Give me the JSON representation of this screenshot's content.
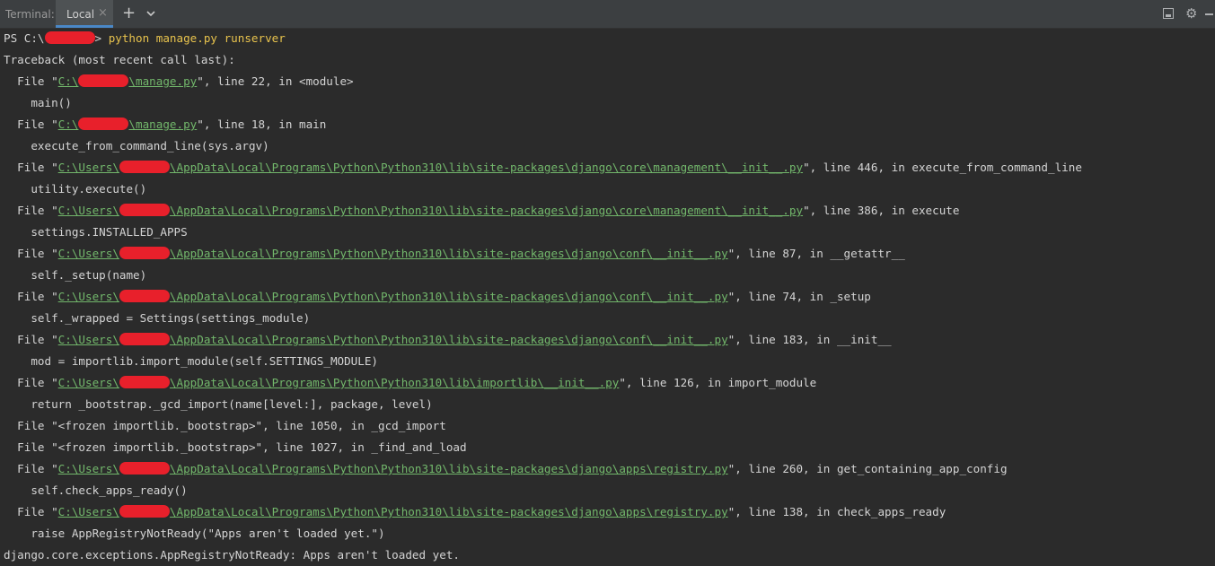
{
  "tabbar": {
    "title": "Terminal:",
    "tab_label": "Local",
    "close_glyph": "×",
    "add_glyph": "+",
    "icons": [
      "new-tab-icon",
      "tab-list-chevron-icon",
      "hide-panel-icon",
      "gear-icon",
      "minimize-icon"
    ]
  },
  "prompt": {
    "prefix": "PS C:\\",
    "suffix": ">",
    "command": "python manage.py runserver"
  },
  "trace": {
    "header": "Traceback (most recent call last):",
    "frames": [
      {
        "file_open": "  File \"",
        "path_a": "C:\\",
        "path_b": "\\manage.py",
        "rest": "\", line 22, in <module>",
        "code": "    main()"
      },
      {
        "file_open": "  File \"",
        "path_a": "C:\\",
        "path_b": "\\manage.py",
        "rest": "\", line 18, in main",
        "code": "    execute_from_command_line(sys.argv)"
      },
      {
        "file_open": "  File \"",
        "path_a": "C:\\Users\\",
        "path_b": "\\AppData\\Local\\Programs\\Python\\Python310\\lib\\site-packages\\django\\core\\management\\__init__.py",
        "rest": "\", line 446, in execute_from_command_line",
        "code": "    utility.execute()"
      },
      {
        "file_open": "  File \"",
        "path_a": "C:\\Users\\",
        "path_b": "\\AppData\\Local\\Programs\\Python\\Python310\\lib\\site-packages\\django\\core\\management\\__init__.py",
        "rest": "\", line 386, in execute",
        "code": "    settings.INSTALLED_APPS"
      },
      {
        "file_open": "  File \"",
        "path_a": "C:\\Users\\",
        "path_b": "\\AppData\\Local\\Programs\\Python\\Python310\\lib\\site-packages\\django\\conf\\__init__.py",
        "rest": "\", line 87, in __getattr__",
        "code": "    self._setup(name)"
      },
      {
        "file_open": "  File \"",
        "path_a": "C:\\Users\\",
        "path_b": "\\AppData\\Local\\Programs\\Python\\Python310\\lib\\site-packages\\django\\conf\\__init__.py",
        "rest": "\", line 74, in _setup",
        "code": "    self._wrapped = Settings(settings_module)"
      },
      {
        "file_open": "  File \"",
        "path_a": "C:\\Users\\",
        "path_b": "\\AppData\\Local\\Programs\\Python\\Python310\\lib\\site-packages\\django\\conf\\__init__.py",
        "rest": "\", line 183, in __init__",
        "code": "    mod = importlib.import_module(self.SETTINGS_MODULE)"
      },
      {
        "file_open": "  File \"",
        "path_a": "C:\\Users\\",
        "path_b": "\\AppData\\Local\\Programs\\Python\\Python310\\lib\\importlib\\__init__.py",
        "rest": "\", line 126, in import_module",
        "code": "    return _bootstrap._gcd_import(name[level:], package, level)"
      }
    ],
    "frozen": [
      "  File \"<frozen importlib._bootstrap>\", line 1050, in _gcd_import",
      "  File \"<frozen importlib._bootstrap>\", line 1027, in _find_and_load"
    ],
    "frames2": [
      {
        "file_open": "  File \"",
        "path_a": "C:\\Users\\",
        "path_b": "\\AppData\\Local\\Programs\\Python\\Python310\\lib\\site-packages\\django\\apps\\registry.py",
        "rest": "\", line 260, in get_containing_app_config",
        "code": "    self.check_apps_ready()"
      },
      {
        "file_open": "  File \"",
        "path_a": "C:\\Users\\",
        "path_b": "\\AppData\\Local\\Programs\\Python\\Python310\\lib\\site-packages\\django\\apps\\registry.py",
        "rest": "\", line 138, in check_apps_ready",
        "code": "    raise AppRegistryNotReady(\"Apps aren't loaded yet.\")"
      }
    ],
    "error": "django.core.exceptions.AppRegistryNotReady: Apps aren't loaded yet."
  }
}
